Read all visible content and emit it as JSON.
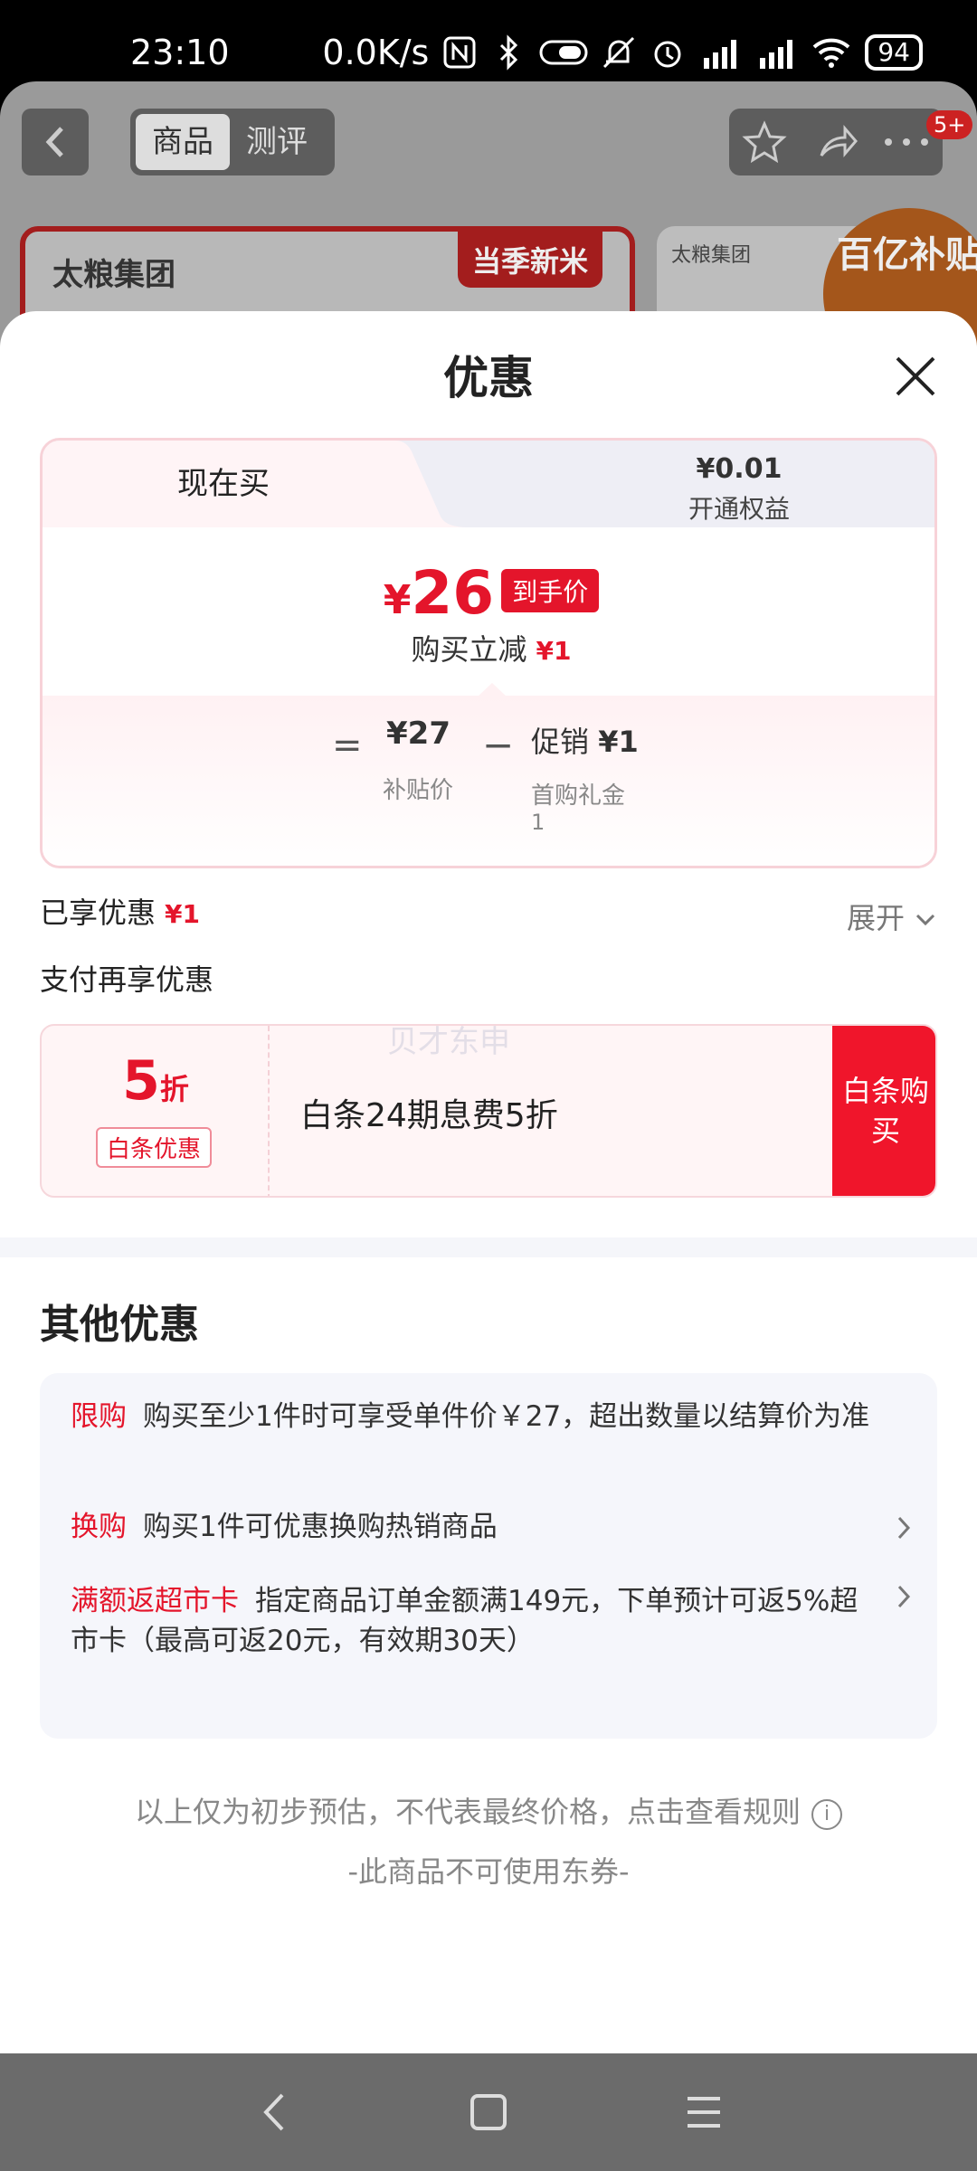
{
  "status_bar": {
    "time": "23:10",
    "net_speed": "0.0K/s",
    "battery": "94",
    "icons": [
      "nfc-icon",
      "bluetooth-icon",
      "toggle-icon",
      "mute-icon",
      "alarm-icon",
      "hd-signal-icon",
      "hd-signal-icon",
      "wifi-icon"
    ]
  },
  "background_page": {
    "tabs": [
      "商品",
      "测评"
    ],
    "badge": "5+",
    "brand": "太粮集团",
    "card_tag": "当季新米",
    "subsidy_badge": "百亿补贴",
    "card2_brand": "太粮集团"
  },
  "sheet": {
    "title": "优惠",
    "price_tabs": {
      "now_label": "现在买",
      "member_price": "¥0.01",
      "member_label": "开通权益"
    },
    "final_price": {
      "currency": "¥",
      "amount": "26",
      "tag": "到手价"
    },
    "instant_reduce": {
      "label": "购买立减",
      "value": "¥1"
    },
    "breakdown": {
      "equals": "=",
      "base_value": "¥27",
      "base_label": "补贴价",
      "minus": "−",
      "promo_prefix": "促销",
      "promo_value": "¥1",
      "promo_label": "首购礼金",
      "promo_count": "1"
    },
    "enjoyed": {
      "label": "已享优惠",
      "value": "¥1"
    },
    "expand_label": "展开",
    "pay_extra_label": "支付再享优惠",
    "baitiao_card": {
      "discount_number": "5",
      "discount_unit": "折",
      "tag": "白条优惠",
      "description": "白条24期息费5折",
      "button": "白条购买"
    },
    "watermark": "贝才东申"
  },
  "other": {
    "title": "其他优惠",
    "items": [
      {
        "key": "限购",
        "text": "购买至少1件时可享受单件价￥27，超出数量以结算价为准"
      },
      {
        "key": "换购",
        "text": "购买1件可优惠换购热销商品"
      },
      {
        "key": "满额返超市卡",
        "text": "指定商品订单金额满149元，下单预计可返5%超市卡（最高可返20元，有效期30天）"
      }
    ],
    "footnote": "以上仅为初步预估，不代表最终价格，点击查看规则",
    "footnote2": "-此商品不可使用东券-"
  },
  "colors": {
    "accent_red": "#e4152b",
    "button_red": "#f0152b",
    "muted_gray": "#888888"
  }
}
